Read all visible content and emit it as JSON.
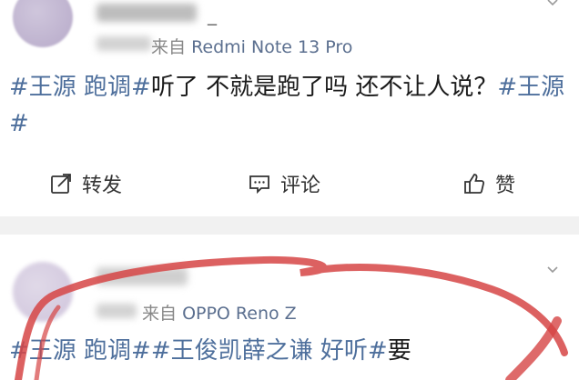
{
  "posts": [
    {
      "username_visible": "_",
      "source_prefix": "来自",
      "source_device": "Redmi Note 13 Pro",
      "text_tags": [
        "#王源 跑调#"
      ],
      "text_body": "听了 不就是跑了吗 还不让人说？",
      "text_tags_tail": "#王源#",
      "actions": {
        "repost": "转发",
        "comment": "评论",
        "like": "赞"
      }
    },
    {
      "source_prefix": "来自",
      "source_device": "OPPO Reno Z",
      "text_tags": [
        "#王源 跑调#",
        "#王俊凯薛之谦 好听#"
      ],
      "text_body": "要"
    }
  ],
  "colors": {
    "tag": "#4e6f9c",
    "scribble": "#d64545",
    "background": "#f1f1f1"
  }
}
